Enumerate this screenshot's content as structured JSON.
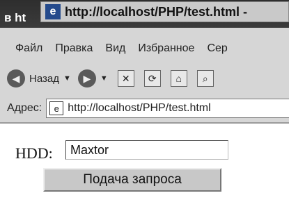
{
  "window": {
    "title_fragment": "в ht",
    "tooltip_url": "http://localhost/PHP/test.html -"
  },
  "menu": [
    "Файл",
    "Правка",
    "Вид",
    "Избранное",
    "Сер"
  ],
  "toolbar": {
    "back_label": "Назад",
    "back_icon": "arrow-left-icon",
    "forward_icon": "arrow-right-icon",
    "stop_icon": "stop-icon",
    "refresh_icon": "refresh-icon",
    "home_icon": "home-icon",
    "search_icon": "search-icon"
  },
  "address": {
    "label": "Адрес:",
    "value": "http://localhost/PHP/test.html"
  },
  "form": {
    "hdd_label": "HDD:",
    "hdd_value": "Maxtor",
    "submit_label": "Подача запроса"
  }
}
